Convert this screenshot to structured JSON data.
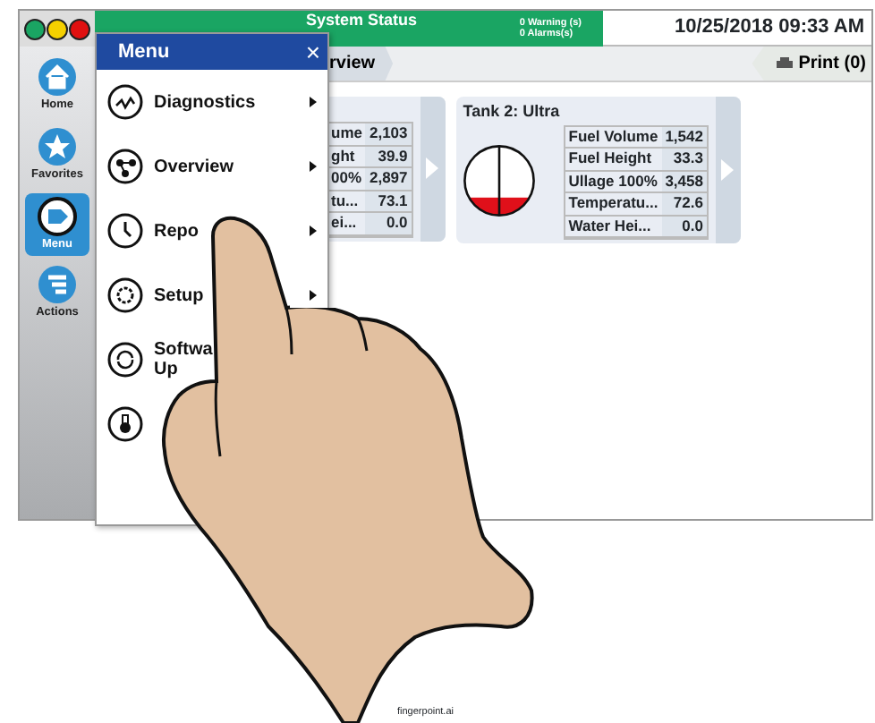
{
  "header": {
    "status_title": "System Status",
    "warnings": "0 Warning (s)",
    "alarms": "0 Alarms(s)",
    "datetime": "10/25/2018 09:33 AM"
  },
  "breadcrumb": {
    "tab": "rview"
  },
  "print_button": {
    "label": "Print (0)"
  },
  "sidebar": [
    {
      "label": "Home",
      "selected": false
    },
    {
      "label": "Favorites",
      "selected": false
    },
    {
      "label": "Menu",
      "selected": true
    },
    {
      "label": "Actions",
      "selected": false
    }
  ],
  "menu": {
    "title": "Menu",
    "close": "×",
    "items": [
      {
        "lines": [
          "Diagnostics"
        ],
        "submenu": true
      },
      {
        "lines": [
          "Overview"
        ],
        "submenu": true
      },
      {
        "lines": [
          "Repo"
        ],
        "submenu": true
      },
      {
        "lines": [
          "Setup"
        ],
        "submenu": true
      },
      {
        "lines": [
          "Softwa",
          "Up"
        ]
      }
    ]
  },
  "tanks": [
    {
      "rows": [
        {
          "label": "ume",
          "value": "2,103"
        },
        {
          "label": "ght",
          "value": "39.9"
        },
        {
          "label": "00%",
          "value": "2,897"
        },
        {
          "label": "tu...",
          "value": "73.1"
        },
        {
          "label": "ei...",
          "value": "0.0"
        }
      ]
    },
    {
      "title": "Tank 2: Ultra",
      "level": 0.3,
      "rows": [
        {
          "label": "Fuel Volume",
          "value": "1,542"
        },
        {
          "label": "Fuel Height",
          "value": "33.3"
        },
        {
          "label": "Ullage 100%",
          "value": "3,458"
        },
        {
          "label": "Temperatu...",
          "value": "72.6"
        },
        {
          "label": "Water Hei...",
          "value": "0.0"
        }
      ]
    }
  ],
  "caption": "fingerpoint.ai"
}
